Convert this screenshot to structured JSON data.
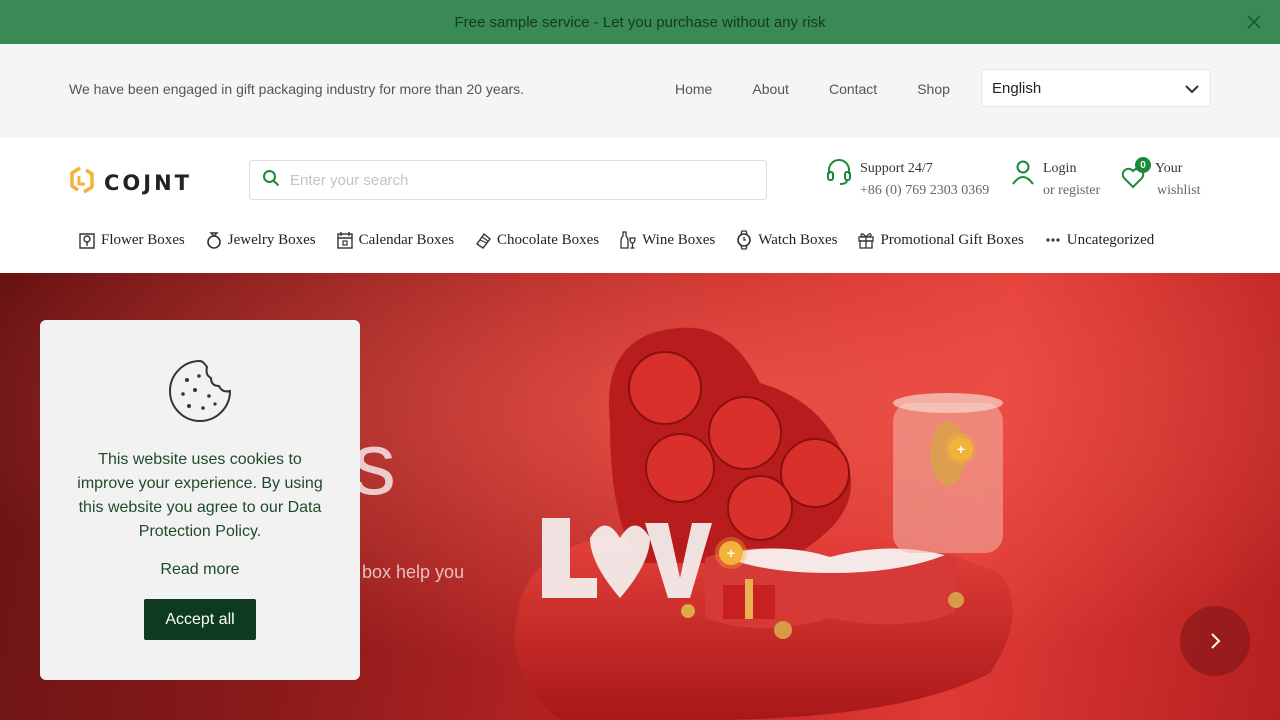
{
  "promo": {
    "text": "Free sample service - Let you purchase without any risk"
  },
  "topbar": {
    "tagline": "We have been engaged in gift packaging industry for more than 20 years.",
    "nav": [
      "Home",
      "About",
      "Contact",
      "Shop"
    ],
    "language": "English"
  },
  "header": {
    "logo": "COJNT",
    "search_placeholder": "Enter your search",
    "support": {
      "title": "Support 24/7",
      "phone": "+86 (0) 769 2303 0369"
    },
    "account": {
      "login": "Login",
      "register": "or register"
    },
    "wishlist": {
      "count": "0",
      "line1": "Your",
      "line2": "wishlist"
    }
  },
  "categories": [
    {
      "label": "Flower Boxes",
      "icon": "flower-icon"
    },
    {
      "label": "Jewelry Boxes",
      "icon": "ring-icon"
    },
    {
      "label": "Calendar Boxes",
      "icon": "calendar-icon"
    },
    {
      "label": "Chocolate Boxes",
      "icon": "chocolate-icon"
    },
    {
      "label": "Wine Boxes",
      "icon": "wine-icon"
    },
    {
      "label": "Watch Boxes",
      "icon": "watch-icon"
    },
    {
      "label": "Promotional Gift Boxes",
      "icon": "gift-icon"
    },
    {
      "label": "Uncategorized",
      "icon": "more-icon"
    }
  ],
  "hero": {
    "title_fragment": "s",
    "subtitle_fragment": "t box help you",
    "hotspot_label": "+"
  },
  "cookie": {
    "message": "This website uses cookies to improve your experience. By using this website you agree to our Data Protection Policy.",
    "read_more": "Read more",
    "accept": "Accept all"
  },
  "colors": {
    "brand_green": "#1a8a3a",
    "promo_bg": "#3a8a55",
    "accept_bg": "#0e3a1f",
    "hero_red": "#c42626"
  }
}
